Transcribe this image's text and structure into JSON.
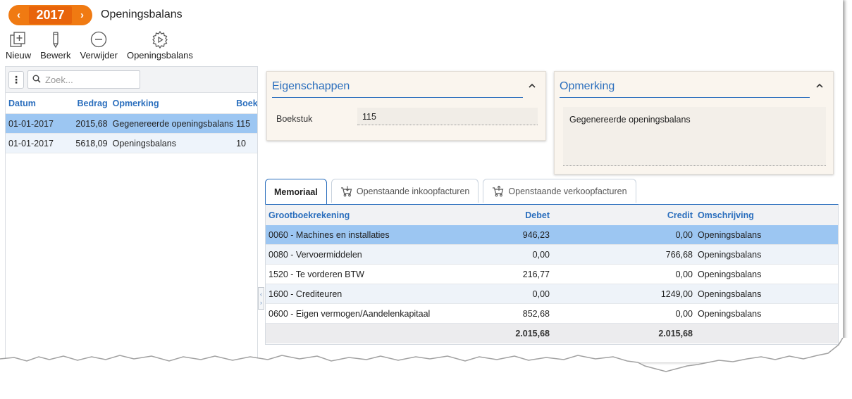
{
  "header": {
    "year": "2017",
    "prev_arrow": "‹",
    "next_arrow": "›",
    "title": "Openingsbalans"
  },
  "toolbar": {
    "items": [
      {
        "label": "Nieuw",
        "icon": "add-document-icon"
      },
      {
        "label": "Bewerk",
        "icon": "pencil-icon"
      },
      {
        "label": "Verwijder",
        "icon": "minus-circle-icon"
      },
      {
        "label": "Openingsbalans",
        "icon": "gear-play-icon"
      }
    ]
  },
  "list": {
    "kebab": "⋮",
    "search_placeholder": "Zoek...",
    "columns": {
      "date": "Datum",
      "amount": "Bedrag",
      "remark": "Opmerking",
      "boek": "Boekstuk"
    },
    "rows": [
      {
        "date": "01-01-2017",
        "amount": "2015,68",
        "remark": "Gegenereerde openingsbalans",
        "boek": "115"
      },
      {
        "date": "01-01-2017",
        "amount": "5618,09",
        "remark": "Openingsbalans",
        "boek": "10"
      }
    ]
  },
  "properties": {
    "title": "Eigenschappen",
    "boekstuk_label": "Boekstuk",
    "boekstuk_value": "115"
  },
  "remark": {
    "title": "Opmerking",
    "text": "Gegenereerde openingsbalans"
  },
  "tabs": [
    {
      "label": "Memoriaal",
      "active": true
    },
    {
      "label": "Openstaande inkoopfacturen",
      "icon": "cart-in-icon"
    },
    {
      "label": "Openstaande verkoopfacturen",
      "icon": "cart-out-icon"
    }
  ],
  "grid": {
    "columns": {
      "account": "Grootboekrekening",
      "debet": "Debet",
      "credit": "Credit",
      "desc": "Omschrijving"
    },
    "rows": [
      {
        "account": "0060 - Machines en installaties",
        "debet": "946,23",
        "credit": "0,00",
        "desc": "Openingsbalans"
      },
      {
        "account": "0080 - Vervoermiddelen",
        "debet": "0,00",
        "credit": "766,68",
        "desc": "Openingsbalans"
      },
      {
        "account": "1520 - Te vorderen BTW",
        "debet": "216,77",
        "credit": "0,00",
        "desc": "Openingsbalans"
      },
      {
        "account": "1600 - Crediteuren",
        "debet": "0,00",
        "credit": "1249,00",
        "desc": "Openingsbalans"
      },
      {
        "account": "0600 - Eigen vermogen/Aandelenkapitaal",
        "debet": "852,68",
        "credit": "0,00",
        "desc": "Openingsbalans"
      }
    ],
    "totals": {
      "debet": "2.015,68",
      "credit": "2.015,68"
    }
  },
  "colors": {
    "accent": "#2a6ebd",
    "orange": "#f07a12",
    "selection": "#9cc6f2",
    "card_bg": "#faf5ee"
  }
}
